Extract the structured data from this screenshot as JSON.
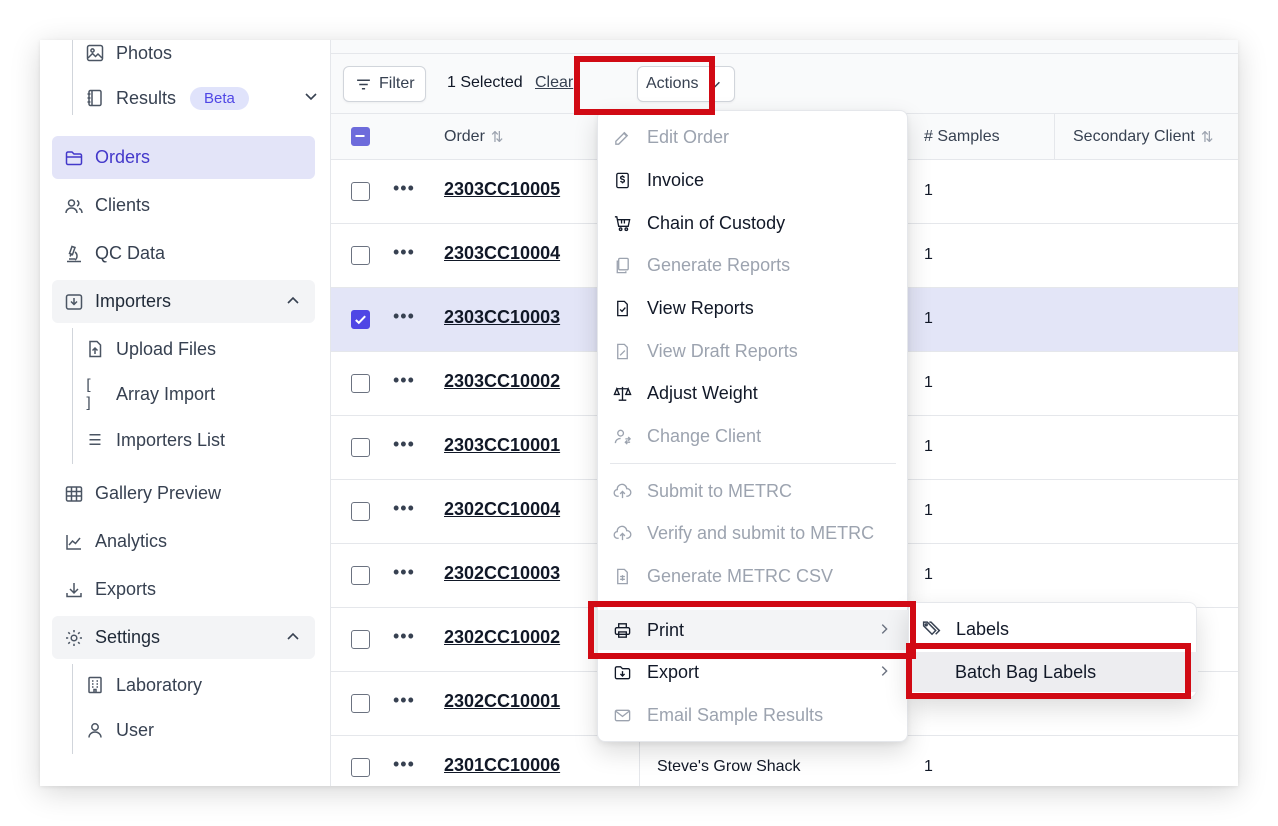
{
  "sidebar": {
    "top_items": [
      {
        "label": "Photos",
        "icon": "image-icon"
      },
      {
        "label": "Results",
        "icon": "notebook-icon",
        "badge": "Beta"
      }
    ],
    "items": [
      {
        "label": "Orders",
        "icon": "folder-icon"
      },
      {
        "label": "Clients",
        "icon": "users-icon"
      },
      {
        "label": "QC Data",
        "icon": "microscope-icon"
      },
      {
        "label": "Importers",
        "icon": "inbox-download-icon"
      },
      {
        "label": "Gallery Preview",
        "icon": "table-grid-icon"
      },
      {
        "label": "Analytics",
        "icon": "chart-icon"
      },
      {
        "label": "Exports",
        "icon": "download-icon"
      },
      {
        "label": "Settings",
        "icon": "gear-icon"
      }
    ],
    "importers_children": [
      {
        "label": "Upload Files",
        "icon": "file-upload-icon"
      },
      {
        "label": "Array Import",
        "icon_text": "[ ]"
      },
      {
        "label": "Importers List",
        "icon_text": "☰"
      }
    ],
    "settings_children": [
      {
        "label": "Laboratory",
        "icon": "building-icon"
      },
      {
        "label": "User",
        "icon": "user-icon"
      }
    ]
  },
  "toolbar": {
    "filter_label": "Filter",
    "selected_text": "1 Selected",
    "clear_label": "Clear",
    "actions_label": "Actions"
  },
  "table": {
    "headers": {
      "order": "Order",
      "samples": "# Samples",
      "secondary_client": "Secondary Client"
    },
    "rows": [
      {
        "order": "2303CC10005",
        "client": "",
        "samples": "1",
        "checked": false
      },
      {
        "order": "2303CC10004",
        "client": "",
        "samples": "1",
        "checked": false
      },
      {
        "order": "2303CC10003",
        "client": "",
        "samples": "1",
        "checked": true
      },
      {
        "order": "2303CC10002",
        "client": "",
        "samples": "1",
        "checked": false
      },
      {
        "order": "2303CC10001",
        "client": "",
        "samples": "1",
        "checked": false
      },
      {
        "order": "2302CC10004",
        "client": "",
        "samples": "1",
        "checked": false
      },
      {
        "order": "2302CC10003",
        "client": "",
        "samples": "1",
        "checked": false
      },
      {
        "order": "2302CC10002",
        "client": "",
        "samples": "",
        "checked": false
      },
      {
        "order": "2302CC10001",
        "client": "",
        "samples": "",
        "checked": false
      },
      {
        "order": "2301CC10006",
        "client": "Steve's Grow Shack",
        "samples": "1",
        "checked": false
      }
    ]
  },
  "actions_menu": {
    "items": [
      {
        "label": "Edit Order",
        "disabled": true
      },
      {
        "label": "Invoice",
        "disabled": false
      },
      {
        "label": "Chain of Custody",
        "disabled": false
      },
      {
        "label": "Generate Reports",
        "disabled": true
      },
      {
        "label": "View Reports",
        "disabled": false
      },
      {
        "label": "View Draft Reports",
        "disabled": true
      },
      {
        "label": "Adjust Weight",
        "disabled": false
      },
      {
        "label": "Change Client",
        "disabled": true
      },
      {
        "label": "Submit to METRC",
        "disabled": true
      },
      {
        "label": "Verify and submit to METRC",
        "disabled": true
      },
      {
        "label": "Generate METRC CSV",
        "disabled": true
      },
      {
        "label": "Print",
        "disabled": false
      },
      {
        "label": "Export",
        "disabled": false
      },
      {
        "label": "Email Sample Results",
        "disabled": true
      }
    ]
  },
  "print_submenu": {
    "items": [
      {
        "label": "Labels"
      },
      {
        "label": "Batch Bag Labels"
      }
    ]
  },
  "colors": {
    "accent": "#4f46e5",
    "highlight_red": "#d10a14",
    "selected_row": "#e3e5f7"
  }
}
